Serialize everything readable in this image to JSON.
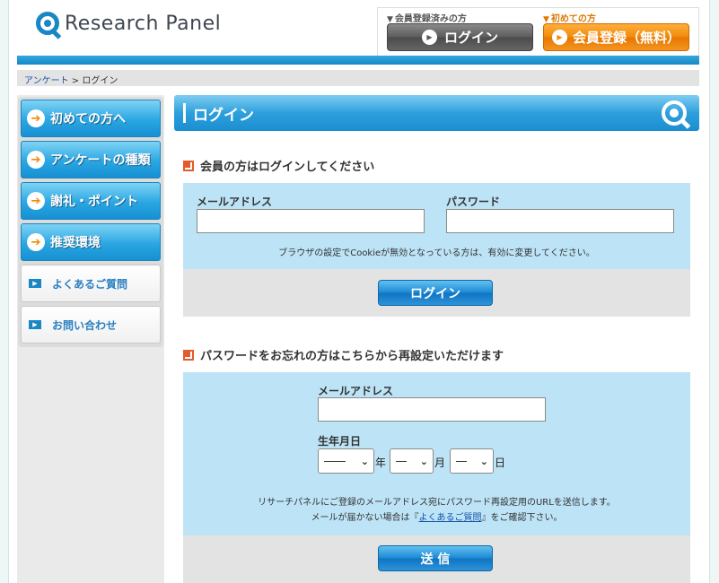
{
  "header": {
    "logo_text": "Research Panel",
    "member_caption": "会員登録済みの方",
    "new_caption": "初めての方",
    "login_button": "ログイン",
    "register_button": "会員登録（無料）"
  },
  "breadcrumb": {
    "home": "アンケート",
    "separator": " > ",
    "current": "ログイン"
  },
  "sidebar": {
    "items": [
      {
        "label": "初めての方へ"
      },
      {
        "label": "アンケートの種類"
      },
      {
        "label": "謝礼・ポイント"
      },
      {
        "label": "推奨環境"
      },
      {
        "label": "よくあるご質問"
      },
      {
        "label": "お問い合わせ"
      }
    ]
  },
  "main": {
    "title": "ログイン",
    "login_section": {
      "heading": "会員の方はログインしてください",
      "email_label": "メールアドレス",
      "password_label": "パスワード",
      "email_value": "",
      "password_value": "",
      "cookie_note": "ブラウザの設定でCookieが無効となっている方は、有効に変更してください。",
      "submit": "ログイン"
    },
    "reset_section": {
      "heading": "パスワードをお忘れの方はこちらから再設定いただけます",
      "email_label": "メールアドレス",
      "email_value": "",
      "birthday_label": "生年月日",
      "year_value": "――",
      "month_value": "―",
      "day_value": "―",
      "year_unit": "年",
      "month_unit": "月",
      "day_unit": "日",
      "note_line1": "リサーチパネルにご登録のメールアドレス宛にパスワード再設定用のURLを送信します。",
      "note_line2_pre": "メールが届かない場合は『",
      "note_line2_link": "よくあるご質問",
      "note_line2_post": "』をご確認下さい。",
      "submit": "送 信"
    }
  },
  "colors": {
    "accent": "#1b8ed0",
    "orange": "#f08a0c",
    "panel": "#bde3f6"
  }
}
